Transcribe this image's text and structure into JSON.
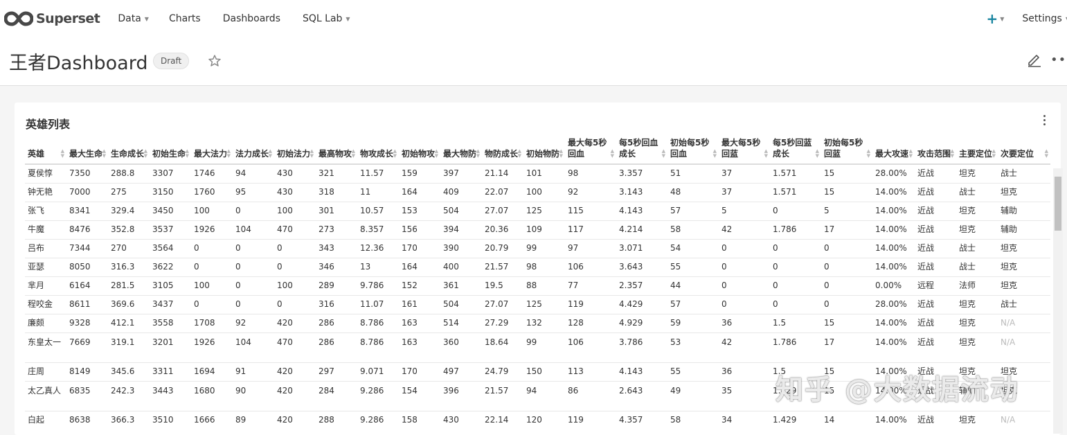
{
  "nav": {
    "brand": "Superset",
    "items": [
      {
        "label": "Data",
        "has_caret": true
      },
      {
        "label": "Charts",
        "has_caret": false
      },
      {
        "label": "Dashboards",
        "has_caret": false
      },
      {
        "label": "SQL Lab",
        "has_caret": true
      }
    ],
    "settings_label": "Settings"
  },
  "dashboard": {
    "title": "王者Dashboard",
    "status_badge": "Draft"
  },
  "chart": {
    "title": "英雄列表",
    "columns": [
      "英雄",
      "最大生命",
      "生命成长",
      "初始生命",
      "最大法力",
      "法力成长",
      "初始法力",
      "最高物攻",
      "物攻成长",
      "初始物攻",
      "最大物防",
      "物防成长",
      "初始物防",
      "最大每5秒回血",
      "每5秒回血成长",
      "初始每5秒回血",
      "最大每5秒回蓝",
      "每5秒回蓝成长",
      "初始每5秒回蓝",
      "最大攻速",
      "攻击范围",
      "主要定位",
      "次要定位"
    ],
    "rows": [
      [
        "夏侯惇",
        "7350",
        "288.8",
        "3307",
        "1746",
        "94",
        "430",
        "321",
        "11.57",
        "159",
        "397",
        "21.14",
        "101",
        "98",
        "3.357",
        "51",
        "37",
        "1.571",
        "15",
        "28.00%",
        "近战",
        "坦克",
        "战士"
      ],
      [
        "钟无艳",
        "7000",
        "275",
        "3150",
        "1760",
        "95",
        "430",
        "318",
        "11",
        "164",
        "409",
        "22.07",
        "100",
        "92",
        "3.143",
        "48",
        "37",
        "1.571",
        "15",
        "14.00%",
        "近战",
        "战士",
        "坦克"
      ],
      [
        "张飞",
        "8341",
        "329.4",
        "3450",
        "100",
        "0",
        "100",
        "301",
        "10.57",
        "153",
        "504",
        "27.07",
        "125",
        "115",
        "4.143",
        "57",
        "5",
        "0",
        "5",
        "14.00%",
        "近战",
        "坦克",
        "辅助"
      ],
      [
        "牛魔",
        "8476",
        "352.8",
        "3537",
        "1926",
        "104",
        "470",
        "273",
        "8.357",
        "156",
        "394",
        "20.36",
        "109",
        "117",
        "4.214",
        "58",
        "42",
        "1.786",
        "17",
        "14.00%",
        "近战",
        "坦克",
        "辅助"
      ],
      [
        "吕布",
        "7344",
        "270",
        "3564",
        "0",
        "0",
        "0",
        "343",
        "12.36",
        "170",
        "390",
        "20.79",
        "99",
        "97",
        "3.071",
        "54",
        "0",
        "0",
        "0",
        "14.00%",
        "近战",
        "战士",
        "坦克"
      ],
      [
        "亚瑟",
        "8050",
        "316.3",
        "3622",
        "0",
        "0",
        "0",
        "346",
        "13",
        "164",
        "400",
        "21.57",
        "98",
        "106",
        "3.643",
        "55",
        "0",
        "0",
        "0",
        "14.00%",
        "近战",
        "战士",
        "坦克"
      ],
      [
        "芈月",
        "6164",
        "281.5",
        "3105",
        "100",
        "0",
        "100",
        "289",
        "9.786",
        "152",
        "361",
        "19.5",
        "88",
        "77",
        "2.357",
        "44",
        "0",
        "0",
        "0",
        "0.00%",
        "远程",
        "法师",
        "坦克"
      ],
      [
        "程咬金",
        "8611",
        "369.6",
        "3437",
        "0",
        "0",
        "0",
        "316",
        "11.07",
        "161",
        "504",
        "27.07",
        "125",
        "119",
        "4.429",
        "57",
        "0",
        "0",
        "0",
        "28.00%",
        "近战",
        "坦克",
        "战士"
      ],
      [
        "廉颇",
        "9328",
        "412.1",
        "3558",
        "1708",
        "92",
        "420",
        "286",
        "8.786",
        "163",
        "514",
        "27.29",
        "132",
        "128",
        "4.929",
        "59",
        "36",
        "1.5",
        "15",
        "14.00%",
        "近战",
        "坦克",
        "N/A"
      ],
      [
        "东皇太一",
        "7669",
        "319.1",
        "3201",
        "1926",
        "104",
        "470",
        "286",
        "8.786",
        "163",
        "360",
        "18.64",
        "99",
        "106",
        "3.786",
        "53",
        "42",
        "1.786",
        "17",
        "14.00%",
        "近战",
        "坦克",
        "N/A"
      ],
      [
        "庄周",
        "8149",
        "345.6",
        "3311",
        "1694",
        "91",
        "420",
        "297",
        "9.071",
        "170",
        "497",
        "24.79",
        "150",
        "113",
        "4.143",
        "55",
        "36",
        "1.5",
        "15",
        "14.00%",
        "近战",
        "坦克",
        "坦克"
      ],
      [
        "太乙真人",
        "6835",
        "242.3",
        "3443",
        "1680",
        "90",
        "420",
        "284",
        "9.286",
        "154",
        "396",
        "21.57",
        "94",
        "86",
        "2.643",
        "49",
        "35",
        "1.429",
        "15",
        "14.00%",
        "近战",
        "辅助",
        "坦克"
      ],
      [
        "白起",
        "8638",
        "366.3",
        "3510",
        "1666",
        "89",
        "420",
        "288",
        "9.286",
        "158",
        "430",
        "22.14",
        "120",
        "119",
        "4.357",
        "58",
        "34",
        "1.429",
        "14",
        "14.00%",
        "近战",
        "坦克",
        "N/A"
      ]
    ]
  },
  "watermark": "知乎 @大数据流动",
  "colors": {
    "accent": "#1985a0",
    "na_text": "#bbbbbb"
  }
}
